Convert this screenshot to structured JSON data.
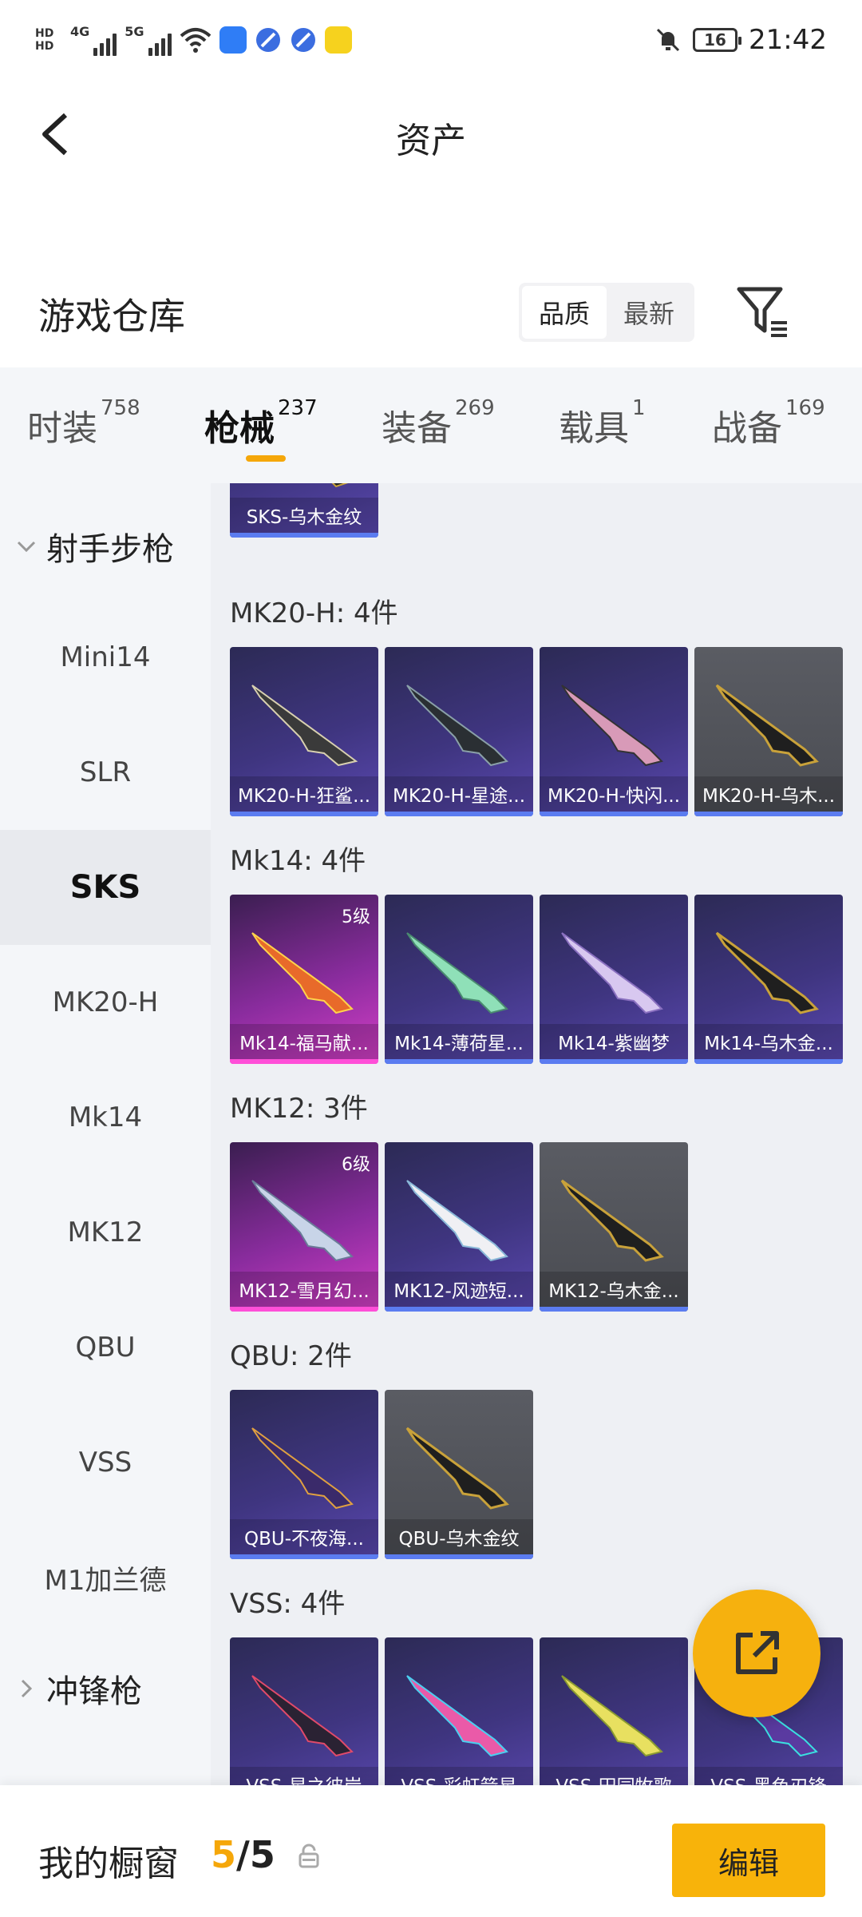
{
  "status_bar": {
    "hd1": "HD",
    "hd2": "HD",
    "net1": "4G",
    "net2": "5G",
    "battery": "16",
    "time": "21:42"
  },
  "header": {
    "title": "资产"
  },
  "warehouse": {
    "title": "游戏仓库",
    "sort_options": [
      "品质",
      "最新"
    ],
    "selected_sort": "品质"
  },
  "tabs": [
    {
      "label": "时装",
      "count": "758"
    },
    {
      "label": "枪械",
      "count": "237"
    },
    {
      "label": "装备",
      "count": "269"
    },
    {
      "label": "载具",
      "count": "1"
    },
    {
      "label": "战备",
      "count": "169"
    }
  ],
  "active_tab": "枪械",
  "sidebar": {
    "category_open": "射手步枪",
    "items": [
      "Mini14",
      "SLR",
      "SKS",
      "MK20-H",
      "Mk14",
      "MK12",
      "QBU",
      "VSS",
      "M1加兰德"
    ],
    "active_item": "SKS",
    "category_closed": "冲锋枪"
  },
  "sections": [
    {
      "title": "",
      "cards": [
        {
          "name": "SKS-乌木金纹",
          "rarity": "purple",
          "level": ""
        }
      ]
    },
    {
      "title": "MK20-H: 4件",
      "cards": [
        {
          "name": "MK20-H-狂鲨...",
          "rarity": "purple",
          "level": ""
        },
        {
          "name": "MK20-H-星途...",
          "rarity": "purple",
          "level": ""
        },
        {
          "name": "MK20-H-快闪...",
          "rarity": "purple",
          "level": ""
        },
        {
          "name": "MK20-H-乌木...",
          "rarity": "gray",
          "level": ""
        }
      ]
    },
    {
      "title": "Mk14: 4件",
      "cards": [
        {
          "name": "Mk14-福马献...",
          "rarity": "pink",
          "level": "5级"
        },
        {
          "name": "Mk14-薄荷星...",
          "rarity": "purple",
          "level": ""
        },
        {
          "name": "Mk14-紫幽梦",
          "rarity": "purple",
          "level": ""
        },
        {
          "name": "Mk14-乌木金...",
          "rarity": "purple",
          "level": ""
        }
      ]
    },
    {
      "title": "MK12: 3件",
      "cards": [
        {
          "name": "MK12-雪月幻...",
          "rarity": "pink",
          "level": "6级"
        },
        {
          "name": "MK12-风迹短...",
          "rarity": "purple",
          "level": ""
        },
        {
          "name": "MK12-乌木金...",
          "rarity": "gray",
          "level": ""
        }
      ]
    },
    {
      "title": "QBU: 2件",
      "cards": [
        {
          "name": "QBU-不夜海...",
          "rarity": "purple",
          "level": ""
        },
        {
          "name": "QBU-乌木金纹",
          "rarity": "gray",
          "level": ""
        }
      ]
    },
    {
      "title": "VSS: 4件",
      "cards": [
        {
          "name": "VSS-星之彼岸",
          "rarity": "purple",
          "level": ""
        },
        {
          "name": "VSS-彩虹箭星",
          "rarity": "purple",
          "level": ""
        },
        {
          "name": "VSS-田园牧歌",
          "rarity": "purple",
          "level": ""
        },
        {
          "name": "VSS-黑色刃锋",
          "rarity": "purple",
          "level": ""
        }
      ]
    }
  ],
  "bottom_bar": {
    "title": "我的橱窗",
    "current": "5",
    "separator": "/",
    "total": "5",
    "edit_label": "编辑"
  },
  "colors": {
    "accent": "#f5a70a",
    "purple_card": "#3f3580",
    "pink_card": "#d43fc6",
    "gray_card": "#4a4c52"
  }
}
